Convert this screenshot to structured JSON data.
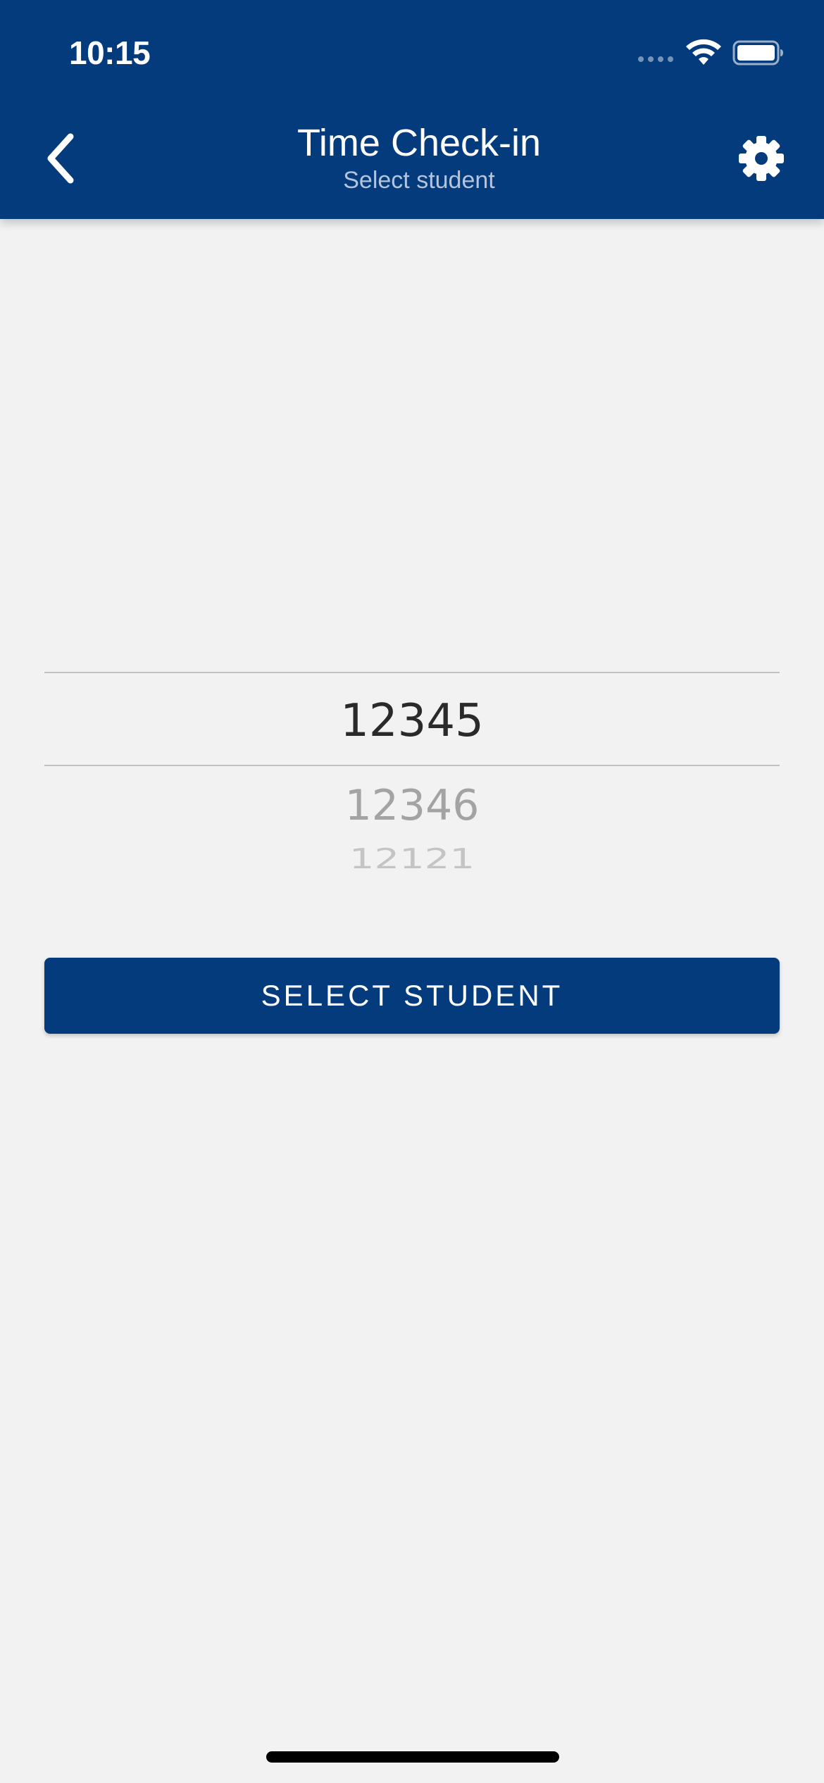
{
  "status_bar": {
    "time": "10:15",
    "wifi_icon": "wifi-icon",
    "battery_icon": "battery-icon",
    "signal_icon": "cellular-signal-icon"
  },
  "header": {
    "title": "Time Check-in",
    "subtitle": "Select student",
    "back_icon": "chevron-left-icon",
    "settings_icon": "gear-icon",
    "background_color": "#043b7c"
  },
  "picker": {
    "selected": "12345",
    "options": [
      "12345",
      "12346",
      "12121"
    ]
  },
  "actions": {
    "select_button_label": "SELECT STUDENT"
  },
  "colors": {
    "brand": "#043b7c",
    "background": "#f2f2f2"
  }
}
